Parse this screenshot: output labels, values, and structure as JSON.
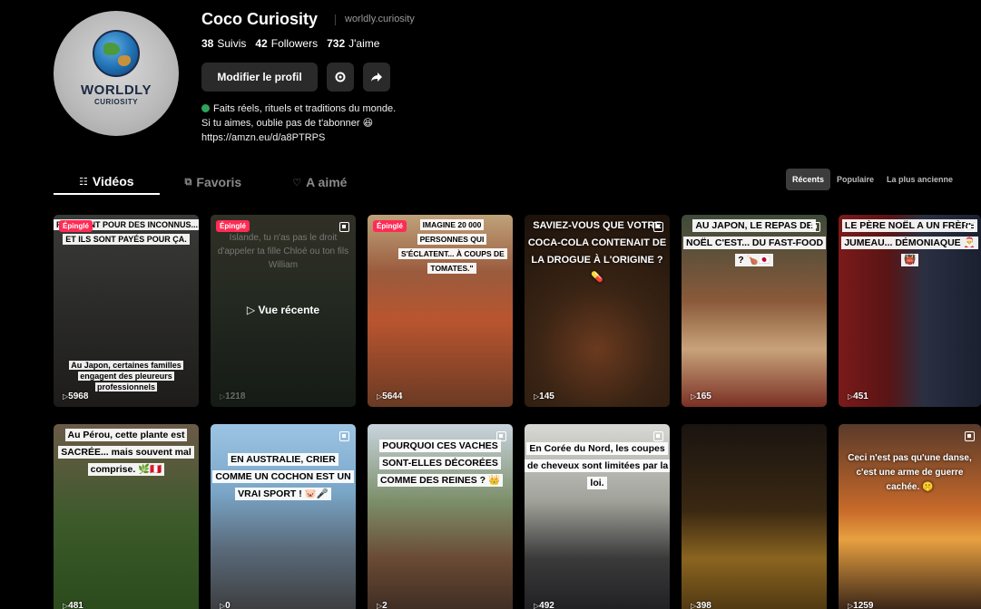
{
  "profile": {
    "logo_main": "WORLDLY",
    "logo_sub": "CURIOSITY",
    "name": "Coco Curiosity",
    "handle": "worldly.curiosity",
    "stats": [
      {
        "value": "38",
        "label": "Suivis"
      },
      {
        "value": "42",
        "label": "Followers"
      },
      {
        "value": "732",
        "label": "J'aime"
      }
    ],
    "edit_label": "Modifier le profil",
    "bio_line1": "Faits réels, rituels et traditions du monde.",
    "bio_line2": "Si tu aimes, oublie pas de t'abonner 😆",
    "bio_link": "https://amzn.eu/d/a8PTRPS"
  },
  "tabs": [
    {
      "label": "Vidéos",
      "icon": "grid-icon"
    },
    {
      "label": "Favoris",
      "icon": "bookmark-icon"
    },
    {
      "label": "A aimé",
      "icon": "heart-icon"
    }
  ],
  "sort": [
    "Récents",
    "Populaire",
    "La plus ancienne"
  ],
  "pinned_label": "Épinglé",
  "recent_label": "▷ Vue récente",
  "videos": [
    {
      "text": "PLEURENT POUR DES INCONNUS... ET ILS SONT PAYÉS POUR ÇA.",
      "bottom": "Au Japon, certaines familles engagent des pleureurs professionnels",
      "views": "5968"
    },
    {
      "text": "Islande, tu n'as pas le droit d'appeler ta fille Chloé ou ton fils William",
      "views": "1218"
    },
    {
      "text": "IMAGINE 20 000 PERSONNES QUI S'ÉCLATENT... À COUPS DE TOMATES.\"",
      "views": "5644"
    },
    {
      "text": "SAVIEZ-VOUS QUE VOTRE COCA-COLA CONTENAIT DE LA DROGUE À L'ORIGINE ? 💊",
      "views": "145"
    },
    {
      "text": "AU JAPON, LE REPAS DE NOËL C'EST... DU FAST-FOOD ? 🍗🇯🇵",
      "views": "165"
    },
    {
      "text": "LE PÈRE NOËL A UN FRÈRE JUMEAU... DÉMONIAQUE 🎅👹",
      "views": "451"
    },
    {
      "text": "Au Pérou, cette plante est SACRÉE... mais souvent mal comprise. 🌿🇵🇪",
      "views": "481"
    },
    {
      "text": "EN AUSTRALIE, CRIER COMME UN COCHON EST UN VRAI SPORT ! 🐷🎤",
      "views": "0"
    },
    {
      "text": "POURQUOI CES VACHES SONT-ELLES DÉCORÉES COMME DES REINES ? 👑",
      "views": "2"
    },
    {
      "text": "En Corée du Nord, les coupes de cheveux sont limitées par la loi.",
      "views": "492"
    },
    {
      "text": "",
      "views": "398"
    },
    {
      "text": "Ceci n'est pas qu'une danse, c'est une arme de guerre cachée. 🤫",
      "views": "1259"
    }
  ]
}
